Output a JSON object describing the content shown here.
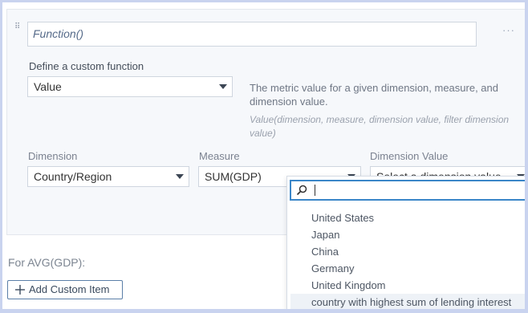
{
  "custom_item": {
    "function_placeholder": "Function()",
    "more_label": "···",
    "define_label": "Define a custom function",
    "function_select": "Value",
    "description": "The metric value for a given dimension, measure, and dimension value.",
    "syntax": "Value(dimension, measure, dimension value, filter dimension value)"
  },
  "fields": {
    "dimension_label": "Dimension",
    "dimension_value": "Country/Region",
    "measure_label": "Measure",
    "measure_value": "SUM(GDP)",
    "dimension_value_label": "Dimension Value",
    "dimension_value_placeholder": "Select a dimension value"
  },
  "dropdown": {
    "search_value": "",
    "options": [
      "United States",
      "Japan",
      "China",
      "Germany",
      "United Kingdom",
      "country with highest sum of lending interest"
    ]
  },
  "footer": {
    "for_label": "For AVG(GDP):",
    "add_button_label": "Add Custom Item"
  },
  "colors": {
    "accent": "#3a86c8",
    "panel_bg": "#f6f8fb"
  }
}
